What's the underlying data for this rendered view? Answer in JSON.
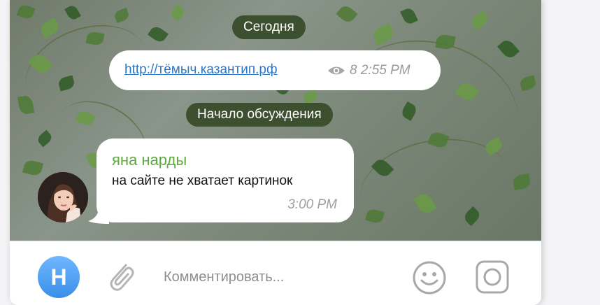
{
  "chat": {
    "date_label": "Сегодня",
    "discussion_start_label": "Начало обсуждения",
    "post": {
      "link_text": "http://тёмыч.казантип.рф",
      "views": "8",
      "time": "2:55 PM"
    },
    "message": {
      "sender": "яна нарды",
      "text": "на сайте не хватает картинок",
      "time": "3:00 PM"
    }
  },
  "composer": {
    "avatar_letter": "Н",
    "placeholder": "Комментировать..."
  },
  "colors": {
    "pill_bg": "#3c4f2e",
    "link": "#2b78c8",
    "sender_name": "#5daa3c",
    "avatar_gradient": "#3a8ee8"
  },
  "icons": [
    "eye-icon",
    "paperclip-icon",
    "emoji-icon",
    "camera-icon"
  ]
}
